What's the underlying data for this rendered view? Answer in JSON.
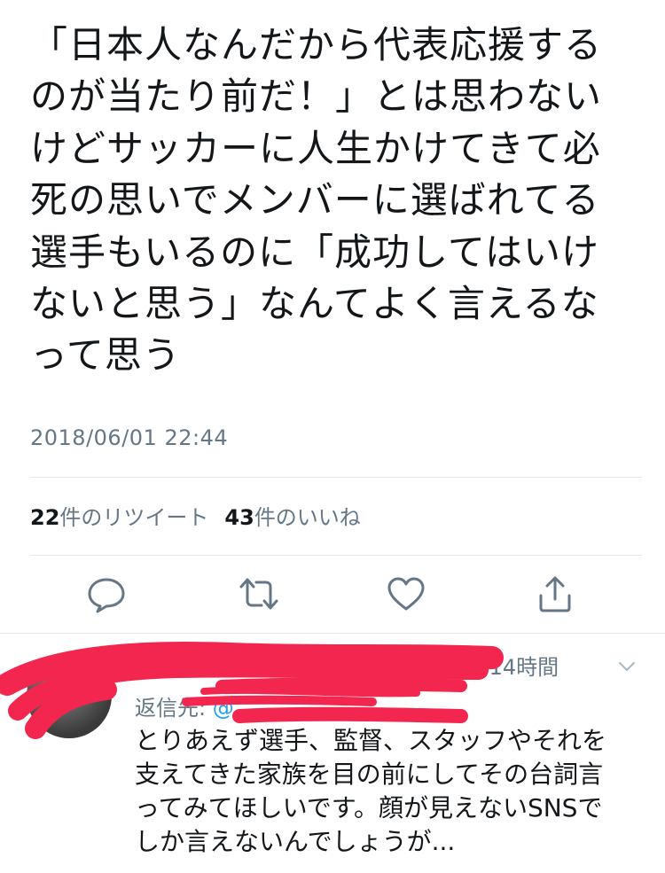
{
  "tweet": {
    "text_lines": [
      "「日本人なんだから代表応援する",
      "のが当たり前だ！」とは思わない",
      "けどサッカーに人生かけてきて必",
      "死の思いでメンバーに選ばれてる",
      "選手もいるのに「成功してはいけ",
      "ないと思う」なんてよく言えるな",
      "って思う"
    ],
    "timestamp": "2018/06/01 22:44",
    "stats": {
      "retweets_count": "22",
      "retweets_label": "件のリツイート",
      "likes_count": "43",
      "likes_label": "件のいいね"
    },
    "actions": [
      {
        "name": "reply",
        "icon": "reply-icon"
      },
      {
        "name": "retweet",
        "icon": "retweet-icon"
      },
      {
        "name": "like",
        "icon": "heart-icon"
      },
      {
        "name": "share",
        "icon": "share-icon"
      }
    ]
  },
  "reply": {
    "name_visible": "...",
    "time": "14時間",
    "reply_to_prefix": "返信先:",
    "reply_to_mention": "@",
    "text_lines": [
      "とりあえず選手、監督、スタッフやそれを",
      "支えてきた家族を目の前にしてその台詞言",
      "ってみてほしいです。顔が見えないSNSで",
      "しか言えないんでしょうが..."
    ]
  },
  "colors": {
    "text": "#14171a",
    "secondary": "#657786",
    "accent": "#1da1f2",
    "redaction": "#f2264f",
    "divider": "#e1e8ed"
  }
}
